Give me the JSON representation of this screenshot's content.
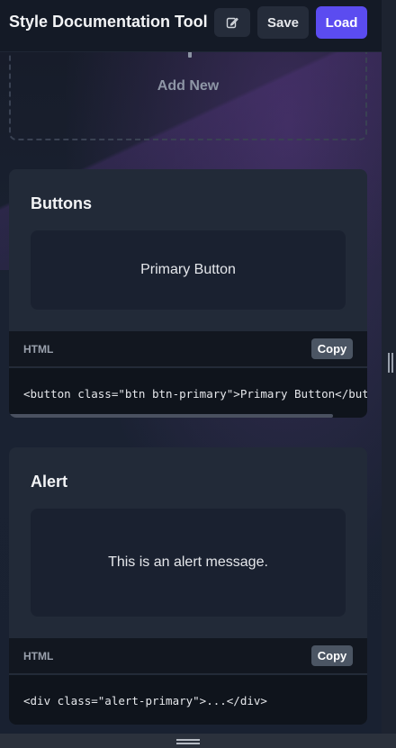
{
  "header": {
    "title": "Style Documentation Tool",
    "edit_icon": "edit-icon",
    "save_label": "Save",
    "load_label": "Load",
    "accent_color": "#5b4cf0"
  },
  "add_new": {
    "label": "Add New",
    "icon": "plus-icon"
  },
  "cards": [
    {
      "title": "Buttons",
      "preview_text": "Primary Button",
      "code_lang": "HTML",
      "copy_label": "Copy",
      "code": "<button class=\"btn btn-primary\">Primary Button</button>"
    },
    {
      "title": "Alert",
      "preview_text": "This is an alert message.",
      "code_lang": "HTML",
      "copy_label": "Copy",
      "code": "<div class=\"alert-primary\">...</div>"
    }
  ]
}
